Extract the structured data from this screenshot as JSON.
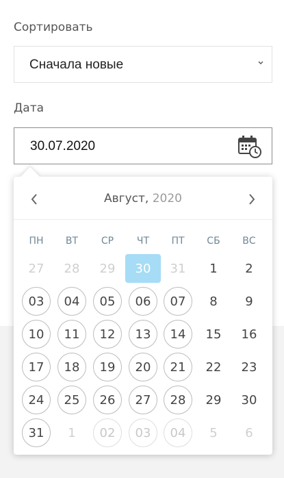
{
  "sort": {
    "label": "Сортировать",
    "value": "Сначала новые"
  },
  "date": {
    "label": "Дата",
    "value": "30.07.2020"
  },
  "calendar": {
    "month": "Август,",
    "year": "2020",
    "weekdays": [
      "ПН",
      "ВТ",
      "СР",
      "ЧТ",
      "ПТ",
      "СБ",
      "ВС"
    ],
    "weeks": [
      [
        {
          "d": "27",
          "s": "muted"
        },
        {
          "d": "28",
          "s": "muted"
        },
        {
          "d": "29",
          "s": "muted"
        },
        {
          "d": "30",
          "s": "selected"
        },
        {
          "d": "31",
          "s": "muted"
        },
        {
          "d": "1",
          "s": "plain"
        },
        {
          "d": "2",
          "s": "plain"
        }
      ],
      [
        {
          "d": "03",
          "s": "avail"
        },
        {
          "d": "04",
          "s": "avail"
        },
        {
          "d": "05",
          "s": "avail"
        },
        {
          "d": "06",
          "s": "avail"
        },
        {
          "d": "07",
          "s": "avail"
        },
        {
          "d": "8",
          "s": "plain"
        },
        {
          "d": "9",
          "s": "plain"
        }
      ],
      [
        {
          "d": "10",
          "s": "avail"
        },
        {
          "d": "11",
          "s": "avail"
        },
        {
          "d": "12",
          "s": "avail"
        },
        {
          "d": "13",
          "s": "avail"
        },
        {
          "d": "14",
          "s": "avail"
        },
        {
          "d": "15",
          "s": "plain"
        },
        {
          "d": "16",
          "s": "plain"
        }
      ],
      [
        {
          "d": "17",
          "s": "avail"
        },
        {
          "d": "18",
          "s": "avail"
        },
        {
          "d": "19",
          "s": "avail"
        },
        {
          "d": "20",
          "s": "avail"
        },
        {
          "d": "21",
          "s": "avail"
        },
        {
          "d": "22",
          "s": "plain"
        },
        {
          "d": "23",
          "s": "plain"
        }
      ],
      [
        {
          "d": "24",
          "s": "avail"
        },
        {
          "d": "25",
          "s": "avail"
        },
        {
          "d": "26",
          "s": "avail"
        },
        {
          "d": "27",
          "s": "avail"
        },
        {
          "d": "28",
          "s": "avail"
        },
        {
          "d": "29",
          "s": "plain"
        },
        {
          "d": "30",
          "s": "plain"
        }
      ],
      [
        {
          "d": "31",
          "s": "avail"
        },
        {
          "d": "1",
          "s": "muted"
        },
        {
          "d": "02",
          "s": "avail-faded"
        },
        {
          "d": "03",
          "s": "avail-faded"
        },
        {
          "d": "04",
          "s": "avail-faded"
        },
        {
          "d": "5",
          "s": "muted"
        },
        {
          "d": "6",
          "s": "muted"
        }
      ]
    ]
  },
  "icons": {
    "select_arrow": "chevron-down-icon",
    "calendar": "calendar-clock-icon",
    "prev": "chevron-left-icon",
    "next": "chevron-right-icon"
  },
  "colors": {
    "selected_day": "#a6dcf5",
    "weekday_text": "#6f8796"
  }
}
